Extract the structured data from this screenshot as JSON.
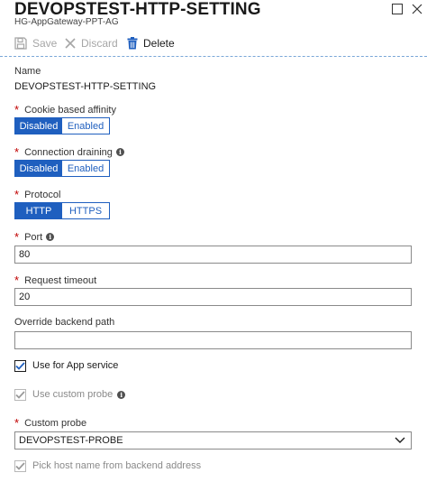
{
  "header": {
    "title": "DEVOPSTEST-HTTP-SETTING",
    "subtitle": "HG-AppGateway-PPT-AG"
  },
  "toolbar": {
    "save_label": "Save",
    "discard_label": "Discard",
    "delete_label": "Delete"
  },
  "form": {
    "name": {
      "label": "Name",
      "value": "DEVOPSTEST-HTTP-SETTING"
    },
    "cookie_affinity": {
      "label": "Cookie based affinity",
      "options": [
        "Disabled",
        "Enabled"
      ],
      "selected": "Disabled"
    },
    "connection_draining": {
      "label": "Connection draining",
      "options": [
        "Disabled",
        "Enabled"
      ],
      "selected": "Disabled"
    },
    "protocol": {
      "label": "Protocol",
      "options": [
        "HTTP",
        "HTTPS"
      ],
      "selected": "HTTP"
    },
    "port": {
      "label": "Port",
      "value": "80"
    },
    "request_timeout": {
      "label": "Request timeout",
      "value": "20"
    },
    "override_path": {
      "label": "Override backend path",
      "value": ""
    },
    "use_app_service": {
      "label": "Use for App service",
      "checked": true
    },
    "use_custom_probe": {
      "label": "Use custom probe",
      "checked": true,
      "disabled": true
    },
    "custom_probe": {
      "label": "Custom probe",
      "selected": "DEVOPSTEST-PROBE"
    },
    "pick_host_name": {
      "label": "Pick host name from backend address",
      "checked": true,
      "disabled": true
    }
  },
  "colors": {
    "accent": "#1f5fbf",
    "required": "#c00000",
    "divider": "#7aa7d8"
  }
}
